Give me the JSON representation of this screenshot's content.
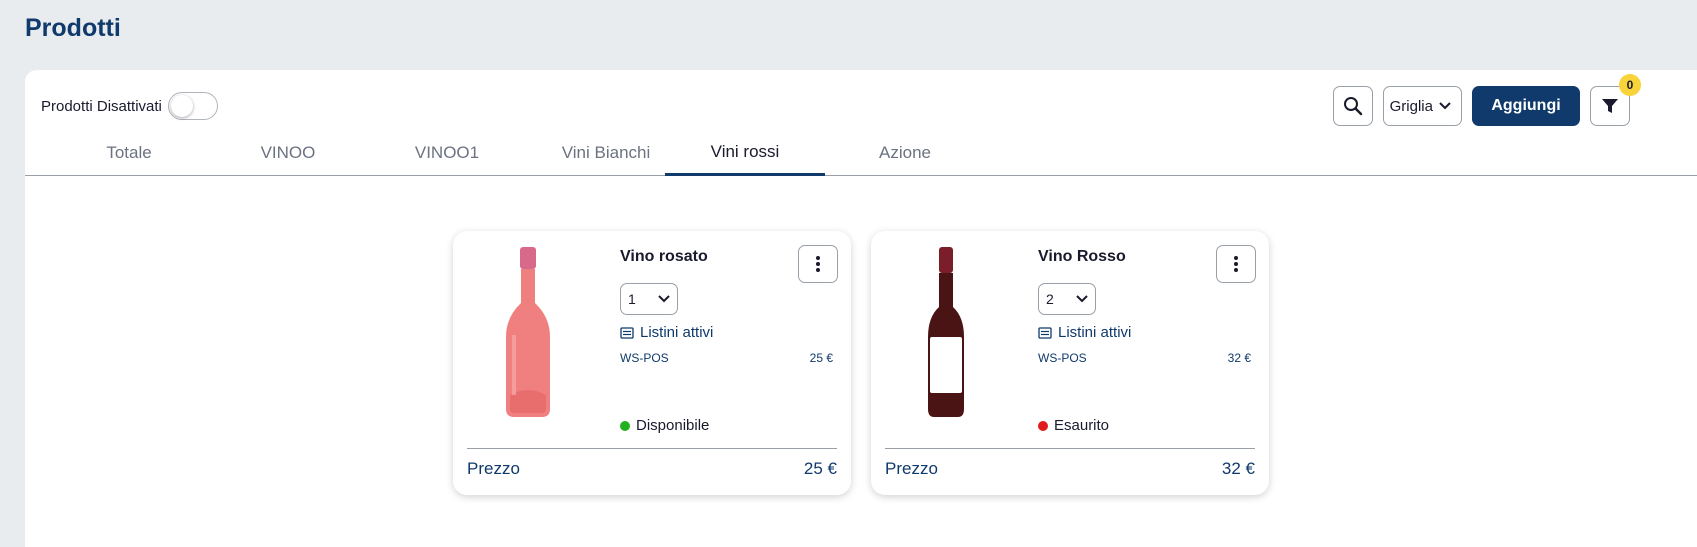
{
  "page": {
    "title": "Prodotti"
  },
  "filters": {
    "deactivated_label": "Prodotti Disattivati",
    "deactivated_on": false
  },
  "toolbar": {
    "view_label": "Griglia",
    "add_label": "Aggiungi",
    "filter_count": "0"
  },
  "tabs": [
    {
      "label": "Totale",
      "active": false
    },
    {
      "label": "VINOO",
      "active": false
    },
    {
      "label": "VINOO1",
      "active": false
    },
    {
      "label": "Vini Bianchi",
      "active": false
    },
    {
      "label": "Vini rossi",
      "active": true
    },
    {
      "label": "Azione",
      "active": false
    }
  ],
  "products": [
    {
      "name": "Vino rosato",
      "quantity": "1",
      "price_lists_label": "Listini attivi",
      "list_code": "WS-POS",
      "list_price": "25 €",
      "status": "Disponibile",
      "status_color": "#22b01f",
      "price_label": "Prezzo",
      "price": "25 €",
      "bottle_color": "#f08080"
    },
    {
      "name": "Vino Rosso",
      "quantity": "2",
      "price_lists_label": "Listini attivi",
      "list_code": "WS-POS",
      "list_price": "32 €",
      "status": "Esaurito",
      "status_color": "#e01b1b",
      "price_label": "Prezzo",
      "price": "32 €",
      "bottle_color": "#4a1414"
    }
  ],
  "colors": {
    "primary": "#0f3a6b",
    "badge": "#f8d33a",
    "background": "#e9ecef"
  }
}
